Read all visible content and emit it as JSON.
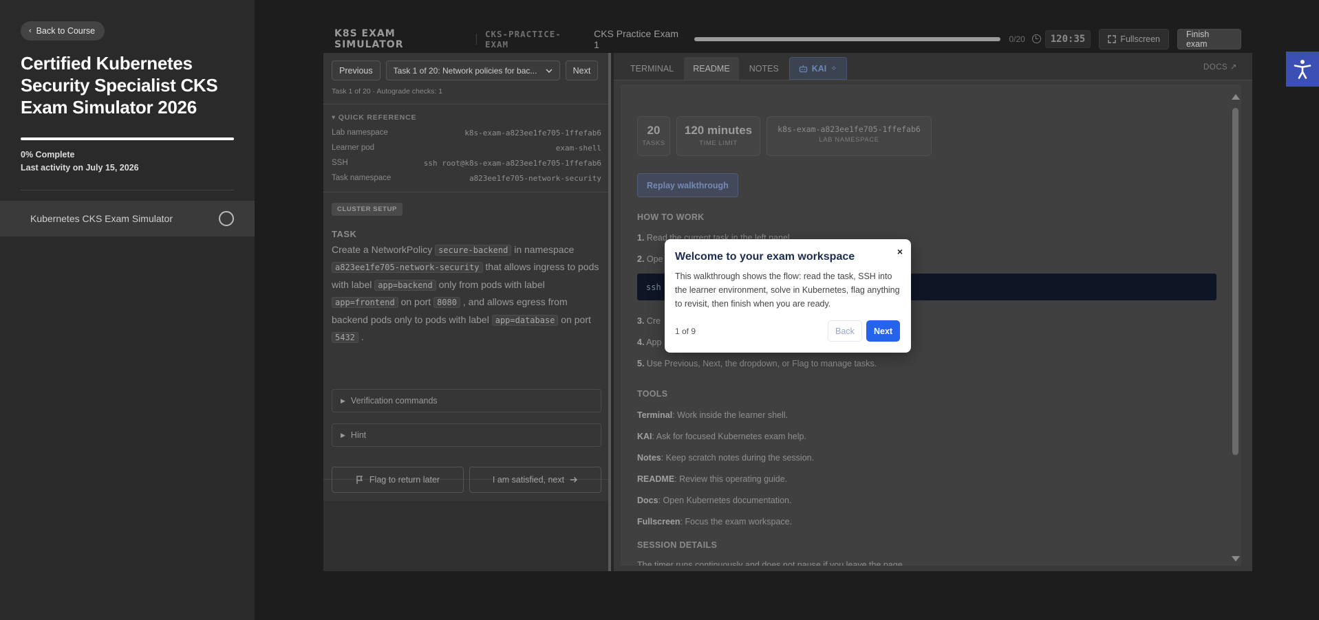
{
  "sidebar": {
    "back_label": "Back to Course",
    "course_title": "Certified Kubernetes Security Specialist CKS Exam Simulator 2026",
    "progress_fraction": 1.0,
    "complete_text": "0% Complete",
    "last_activity": "Last activity on July 15, 2026",
    "module_label": "Kubernetes CKS Exam Simulator"
  },
  "topbar": {
    "brand": "K8S EXAM SIMULATOR",
    "exam_code": "CKS-PRACTICE-EXAM",
    "exam_name": "CKS Practice Exam 1",
    "count": "0/20",
    "timer": "120:35",
    "fullscreen_label": "Fullscreen",
    "finish_label": "Finish exam"
  },
  "task_panel": {
    "prev_label": "Previous",
    "task_select": "Task 1 of 20: Network policies for bac...",
    "next_label": "Next",
    "meta": "Task 1 of 20 · Autograde checks: 1",
    "quick_reference": {
      "title": "QUICK REFERENCE",
      "rows": [
        {
          "label": "Lab namespace",
          "value": "k8s-exam-a823ee1fe705-1ffefab6"
        },
        {
          "label": "Learner pod",
          "value": "exam-shell"
        },
        {
          "label": "SSH",
          "value": "ssh root@k8s-exam-a823ee1fe705-1ffefab6"
        },
        {
          "label": "Task namespace",
          "value": "a823ee1fe705-network-security"
        }
      ]
    },
    "cluster_badge": "CLUSTER SETUP",
    "task_heading": "TASK",
    "task_text": {
      "t1": "Create a NetworkPolicy ",
      "c1": "secure-backend",
      "t2": " in namespace ",
      "c2": "a823ee1fe705-network-security",
      "t3": " that allows ingress to pods with label ",
      "c3": "app=backend",
      "t4": " only from pods with label ",
      "c4": "app=frontend",
      "t5": " on port ",
      "c5": "8080",
      "t6": " , and allows egress from backend pods only to pods with label ",
      "c6": "app=database",
      "t7": " on port ",
      "c7": "5432",
      "t8": " ."
    },
    "verification_label": "Verification commands",
    "hint_label": "Hint",
    "flag_label": "Flag to return later",
    "satisfied_label": "I am satisfied, next"
  },
  "right_panel": {
    "tabs": [
      "TERMINAL",
      "README",
      "NOTES",
      "KAI"
    ],
    "docs_label": "DOCS ↗",
    "stats": [
      {
        "value": "20",
        "label": "TASKS"
      },
      {
        "value": "120 minutes",
        "label": "TIME LIMIT"
      },
      {
        "value": "k8s-exam-a823ee1fe705-1ffefab6",
        "label": "LAB NAMESPACE"
      }
    ],
    "replay_label": "Replay walkthrough",
    "how_to_work": {
      "title": "HOW TO WORK",
      "step1_num": "1.",
      "step1": " Read the current task in the left panel.",
      "step2_num": "2.",
      "step2": " Ope",
      "ssh_cmd": "ssh",
      "step3_num": "3.",
      "step3": " Cre",
      "step4_num": "4.",
      "step4": " App",
      "step5_num": "5.",
      "step5": " Use Previous, Next, the dropdown, or Flag to manage tasks."
    },
    "tools": {
      "title": "TOOLS",
      "items": [
        {
          "name": "Terminal",
          "desc": ": Work inside the learner shell."
        },
        {
          "name": "KAI",
          "desc": ": Ask for focused Kubernetes exam help."
        },
        {
          "name": "Notes",
          "desc": ": Keep scratch notes during the session."
        },
        {
          "name": "README",
          "desc": ": Review this operating guide."
        },
        {
          "name": "Docs",
          "desc": ": Open Kubernetes documentation."
        },
        {
          "name": "Fullscreen",
          "desc": ": Focus the exam workspace."
        }
      ]
    },
    "session_title": "SESSION DETAILS",
    "session_text": "The timer runs continuously and does not pause if you leave the page."
  },
  "modal": {
    "title": "Welcome to your exam workspace",
    "close": "×",
    "body": "This walkthrough shows the flow: read the task, SSH into the learner environment, solve in Kubernetes, flag anything to revisit, then finish when you are ready.",
    "step": "1 of 9",
    "back_label": "Back",
    "next_label": "Next"
  },
  "icons": {
    "back": "chevron-left-icon",
    "module_status": "circle-icon",
    "clock": "clock-icon",
    "fullscreen": "expand-icon",
    "flag": "flag-icon",
    "arrow": "arrow-right-icon",
    "kai": "robot-icon",
    "accessibility": "accessibility-icon"
  },
  "colors": {
    "accent": "#2563eb",
    "accessibility": "#3b4fb4",
    "terminal_bg": "#0e1626"
  }
}
